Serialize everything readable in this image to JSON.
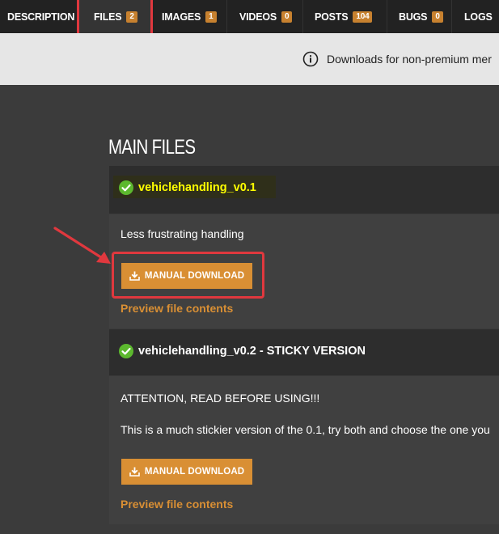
{
  "tabs": [
    {
      "label": "DESCRIPTION",
      "count": null
    },
    {
      "label": "FILES",
      "count": "2"
    },
    {
      "label": "IMAGES",
      "count": "1"
    },
    {
      "label": "VIDEOS",
      "count": "0"
    },
    {
      "label": "POSTS",
      "count": "104"
    },
    {
      "label": "BUGS",
      "count": "0"
    },
    {
      "label": "LOGS",
      "count": null
    }
  ],
  "banner": {
    "text": "Downloads for non-premium mer"
  },
  "section_title": "MAIN FILES",
  "files": [
    {
      "name": "vehiclehandling_v0.1",
      "description": "Less frustrating handling",
      "download_label": "MANUAL DOWNLOAD",
      "preview_label": "Preview file contents"
    },
    {
      "name": "vehiclehandling_v0.2 - STICKY VERSION",
      "description_lines": [
        "ATTENTION, READ BEFORE USING!!!",
        "This is a much stickier version of the 0.1, try both and choose the one you"
      ],
      "download_label": "MANUAL DOWNLOAD",
      "preview_label": "Preview file contents"
    }
  ],
  "colors": {
    "accent": "#d98f34",
    "highlight": "#e0383e",
    "file_name_highlight": "#ffff00"
  }
}
